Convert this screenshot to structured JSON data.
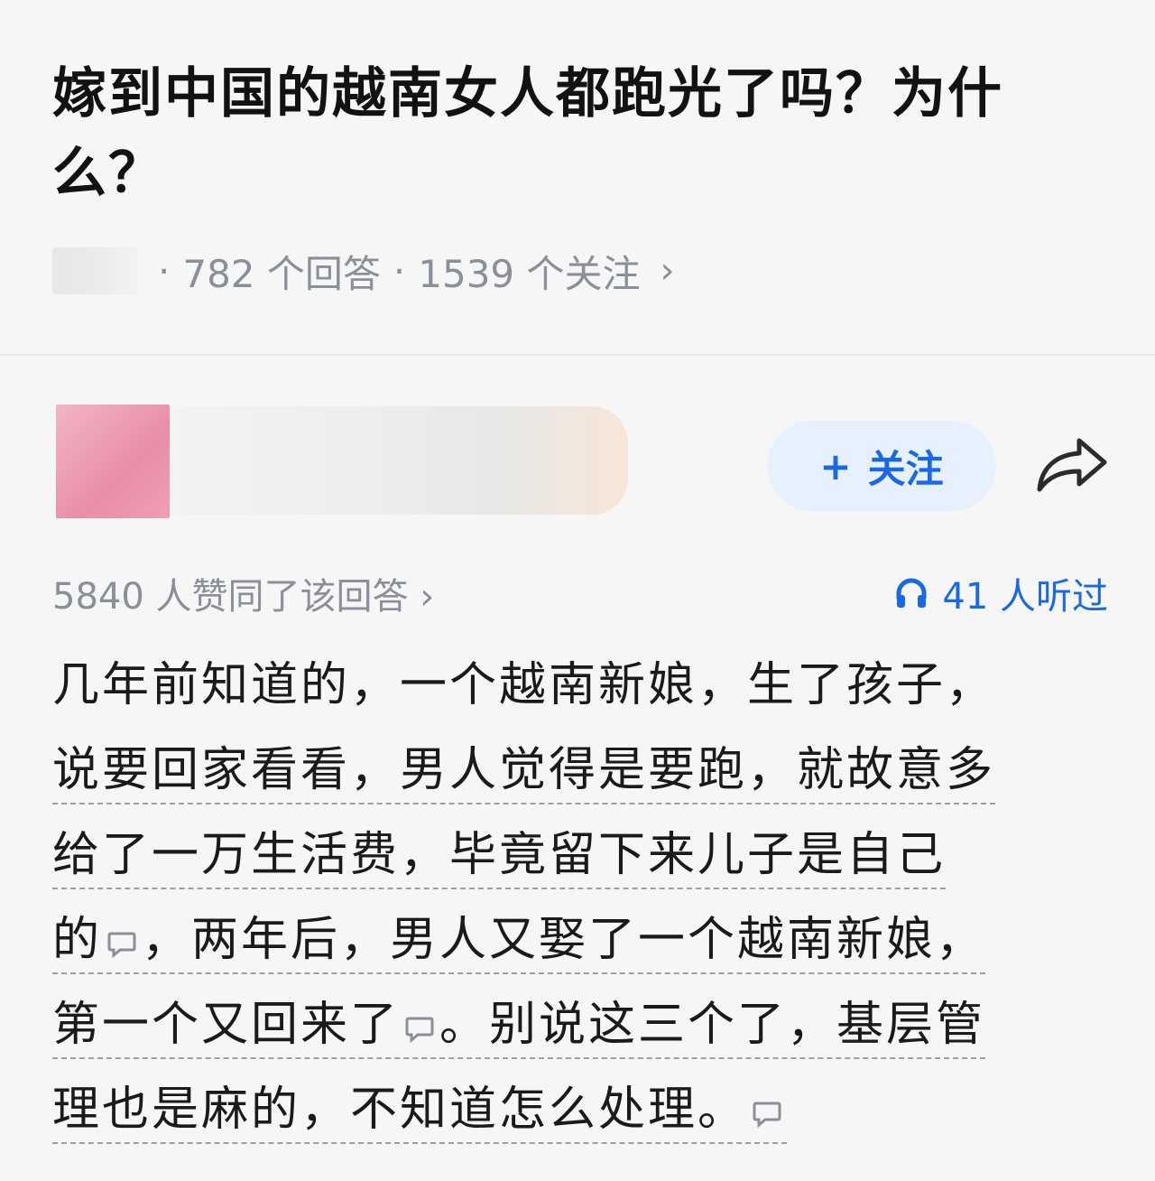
{
  "question": {
    "title": "嫁到中国的越南女人都跑光了吗？为什么？",
    "answer_count": "782 个回答",
    "follower_count": "1539 个关注",
    "meta_sep": "·",
    "chevron": "›"
  },
  "answer": {
    "follow_button": "关注",
    "follow_plus": "+",
    "agree_text": "5840 人赞同了该回答 ›",
    "listened_text": "41 人听过",
    "content": {
      "line1": "几年前知道的，一个越南新娘，生了孩子，",
      "line2": "说要回家看看，男人觉得是要跑，就故意多",
      "line3": "给了一万生活费，毕竟留下来儿子是自己",
      "line4a": "的",
      "line4b": "，两年后，男人又娶了一个越南新娘，",
      "line5a": "第一个又回来了",
      "line5b": "。别说这三个了，基层管",
      "line6a": "理也是麻的，不知道怎么处理。"
    }
  },
  "colors": {
    "accent": "#1969e6",
    "meta_gray": "#8a8f99",
    "follow_bg": "#e7f0fd"
  },
  "icons": [
    "share-icon",
    "headphones-icon",
    "comment-icon",
    "chevron-right-icon"
  ]
}
